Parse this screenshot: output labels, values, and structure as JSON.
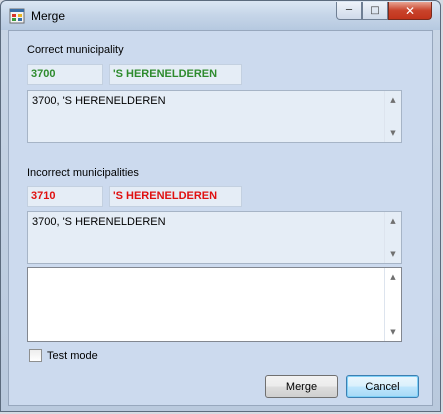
{
  "window": {
    "title": "Merge",
    "minimize_glyph": "─",
    "maximize_glyph": "□",
    "close_glyph": "✕"
  },
  "correct": {
    "label": "Correct municipality",
    "code": "3700",
    "name": "'S HERENELDEREN",
    "list_items": [
      "3700, 'S HERENELDEREN"
    ],
    "color": "#2e8b2e"
  },
  "incorrect": {
    "label": "Incorrect municipalities",
    "code": "3710",
    "name": "'S HERENELDEREN",
    "list_items": [
      "3700, 'S HERENELDEREN"
    ],
    "color": "#e01010"
  },
  "test_mode": {
    "label": "Test mode",
    "checked": false
  },
  "buttons": {
    "merge": "Merge",
    "cancel": "Cancel"
  },
  "scroll": {
    "up_glyph": "▲",
    "down_glyph": "▼"
  }
}
